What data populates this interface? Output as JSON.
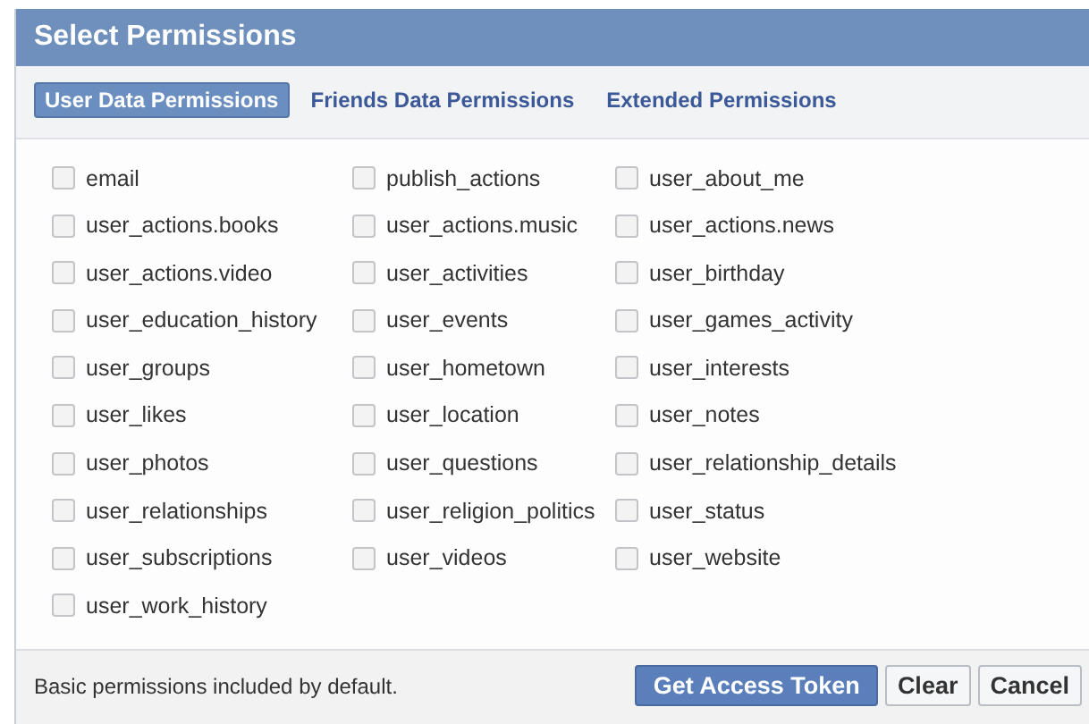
{
  "dialog": {
    "title": "Select Permissions"
  },
  "tabs": [
    {
      "label": "User Data Permissions",
      "selected": true
    },
    {
      "label": "Friends Data Permissions",
      "selected": false
    },
    {
      "label": "Extended Permissions",
      "selected": false
    }
  ],
  "permissions": [
    {
      "label": "email",
      "checked": false
    },
    {
      "label": "publish_actions",
      "checked": false
    },
    {
      "label": "user_about_me",
      "checked": false
    },
    {
      "label": "user_actions.books",
      "checked": false
    },
    {
      "label": "user_actions.music",
      "checked": false
    },
    {
      "label": "user_actions.news",
      "checked": false
    },
    {
      "label": "user_actions.video",
      "checked": false
    },
    {
      "label": "user_activities",
      "checked": false
    },
    {
      "label": "user_birthday",
      "checked": false
    },
    {
      "label": "user_education_history",
      "checked": false
    },
    {
      "label": "user_events",
      "checked": false
    },
    {
      "label": "user_games_activity",
      "checked": false
    },
    {
      "label": "user_groups",
      "checked": false
    },
    {
      "label": "user_hometown",
      "checked": false
    },
    {
      "label": "user_interests",
      "checked": false
    },
    {
      "label": "user_likes",
      "checked": false
    },
    {
      "label": "user_location",
      "checked": false
    },
    {
      "label": "user_notes",
      "checked": false
    },
    {
      "label": "user_photos",
      "checked": false
    },
    {
      "label": "user_questions",
      "checked": false
    },
    {
      "label": "user_relationship_details",
      "checked": false
    },
    {
      "label": "user_relationships",
      "checked": false
    },
    {
      "label": "user_religion_politics",
      "checked": false
    },
    {
      "label": "user_status",
      "checked": false
    },
    {
      "label": "user_subscriptions",
      "checked": false
    },
    {
      "label": "user_videos",
      "checked": false
    },
    {
      "label": "user_website",
      "checked": false
    },
    {
      "label": "user_work_history",
      "checked": false
    }
  ],
  "footer": {
    "note": "Basic permissions included by default.",
    "buttons": [
      {
        "label": "Get Access Token",
        "kind": "primary"
      },
      {
        "label": "Clear",
        "kind": "plain"
      },
      {
        "label": "Cancel",
        "kind": "plain"
      }
    ]
  }
}
